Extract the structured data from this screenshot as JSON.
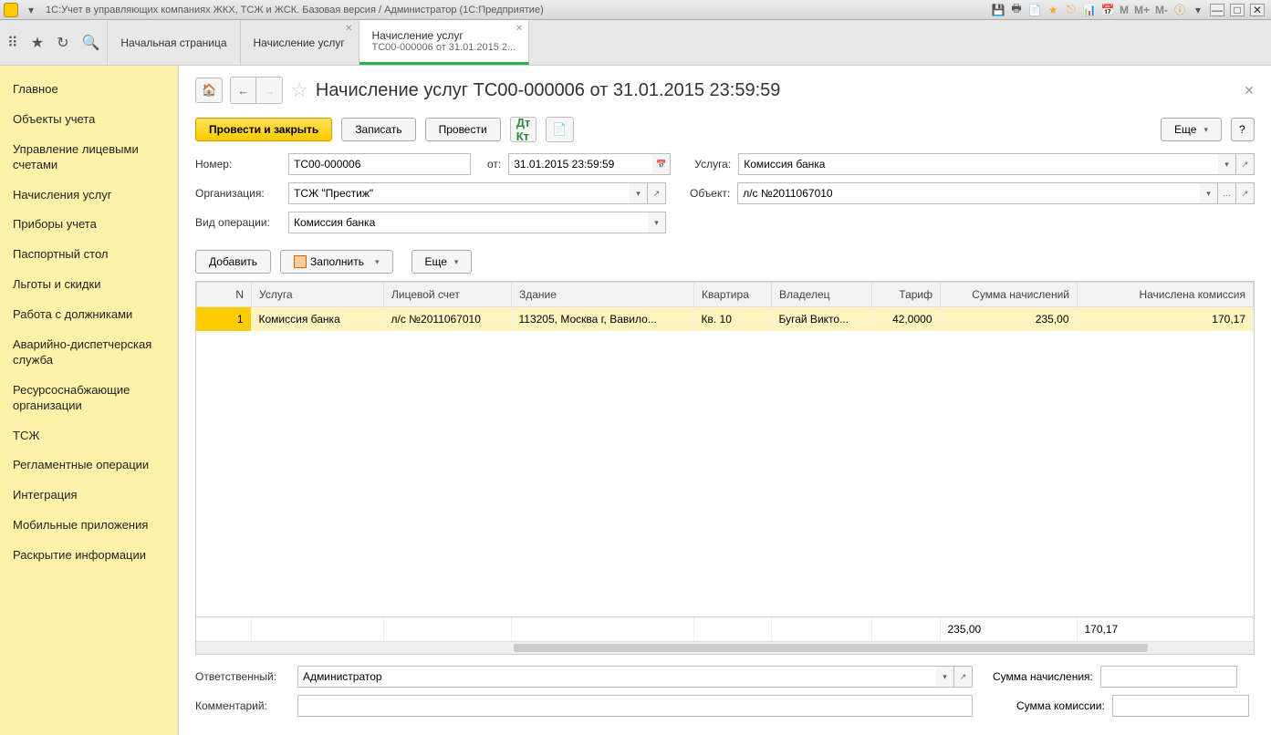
{
  "titlebar": {
    "title": "1С:Учет в управляющих компаниях ЖКХ, ТСЖ и ЖСК. Базовая версия / Администратор  (1С:Предприятие)",
    "m_buttons": [
      "M",
      "M+",
      "M-"
    ]
  },
  "tabs": {
    "home": "Начальная страница",
    "tab1": "Начисление услуг",
    "tab2_line1": "Начисление услуг",
    "tab2_line2": "ТС00-000006 от 31.01.2015 2..."
  },
  "sidebar": {
    "items": [
      "Главное",
      "Объекты учета",
      "Управление лицевыми счетами",
      "Начисления услуг",
      "Приборы учета",
      "Паспортный стол",
      "Льготы и скидки",
      "Работа с должниками",
      "Аварийно-диспетчерская служба",
      "Ресурсоснабжающие организации",
      "ТСЖ",
      "Регламентные операции",
      "Интеграция",
      "Мобильные приложения",
      "Раскрытие информации"
    ]
  },
  "doc": {
    "title": "Начисление услуг ТС00-000006 от 31.01.2015 23:59:59",
    "cmd": {
      "post_close": "Провести и закрыть",
      "save": "Записать",
      "post": "Провести",
      "more": "Еще",
      "help": "?"
    },
    "fields": {
      "number_lbl": "Номер:",
      "number": "ТС00-000006",
      "from_lbl": "от:",
      "date": "31.01.2015 23:59:59",
      "service_lbl": "Услуга:",
      "service": "Комиссия банка",
      "org_lbl": "Организация:",
      "org": "ТСЖ \"Престиж\"",
      "object_lbl": "Объект:",
      "object": "л/с №2011067010",
      "optype_lbl": "Вид операции:",
      "optype": "Комиссия банка"
    },
    "sub": {
      "add": "Добавить",
      "fill": "Заполнить",
      "more": "Еще"
    },
    "grid": {
      "cols": [
        "N",
        "Услуга",
        "Лицевой счет",
        "Здание",
        "Квартира",
        "Владелец",
        "Тариф",
        "Сумма начислений",
        "Начислена комиссия"
      ],
      "rows": [
        {
          "n": "1",
          "service": "Комиссия банка",
          "acc": "л/с №2011067010",
          "building": "113205, Москва г, Вавило...",
          "flat": "Кв. 10",
          "owner": "Бугай Викто...",
          "tarif": "42,0000",
          "sum": "235,00",
          "comm": "170,17"
        }
      ],
      "totals": {
        "sum": "235,00",
        "comm": "170,17"
      }
    },
    "footer": {
      "resp_lbl": "Ответственный:",
      "resp": "Администратор",
      "sum_lbl": "Сумма начисления:",
      "sum": "",
      "comment_lbl": "Комментарий:",
      "comment": "",
      "comm_lbl": "Сумма комиссии:",
      "comm": ""
    }
  }
}
